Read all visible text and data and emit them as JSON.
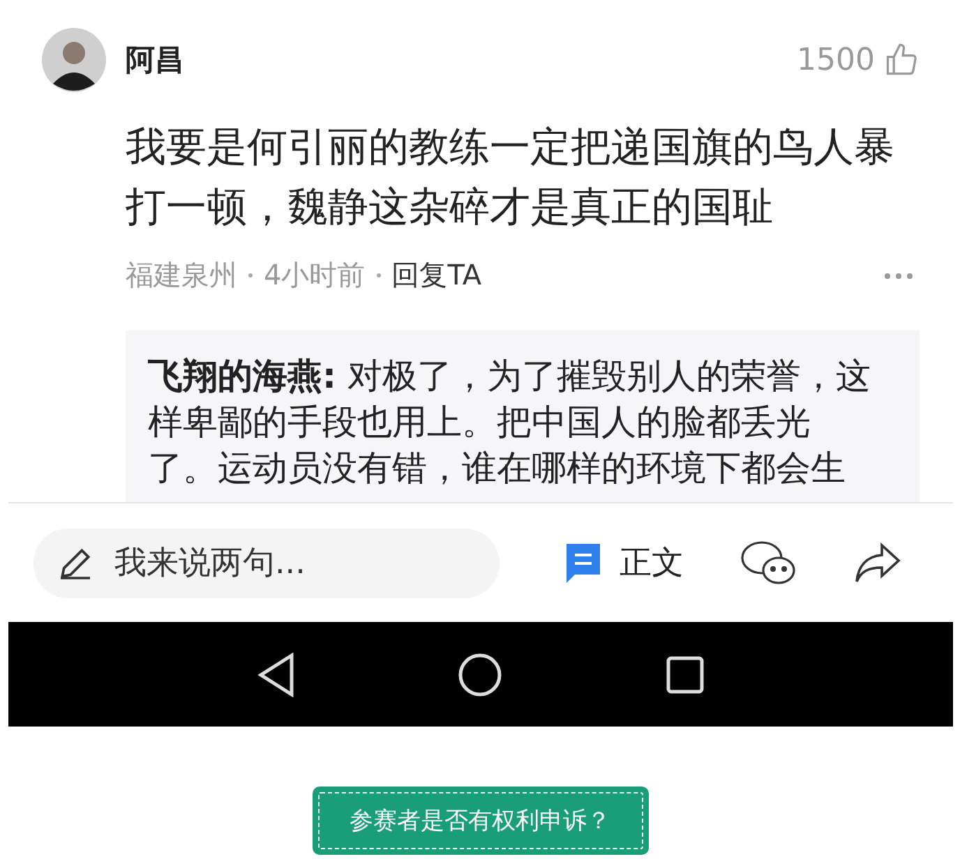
{
  "comment": {
    "author": "阿昌",
    "likes": "1500",
    "text": "我要是何引丽的教练一定把递国旗的鸟人暴打一顿，魏静这杂碎才是真正的国耻",
    "meta": [
      "福建泉州",
      "4小时前"
    ],
    "reply_link": "回复TA"
  },
  "reply": {
    "text": "**飞翔的海燕:** 对极了，为了摧毁别人的荣誉，这样卑鄙的手段也用上。把中国人的脸都丢光了。运动员没有错，谁在哪样的环境下都会生"
  },
  "bottom_bar": {
    "placeholder": "我来说两句...",
    "article_label": "正文"
  },
  "footer_button": "参赛者是否有权利申诉？"
}
